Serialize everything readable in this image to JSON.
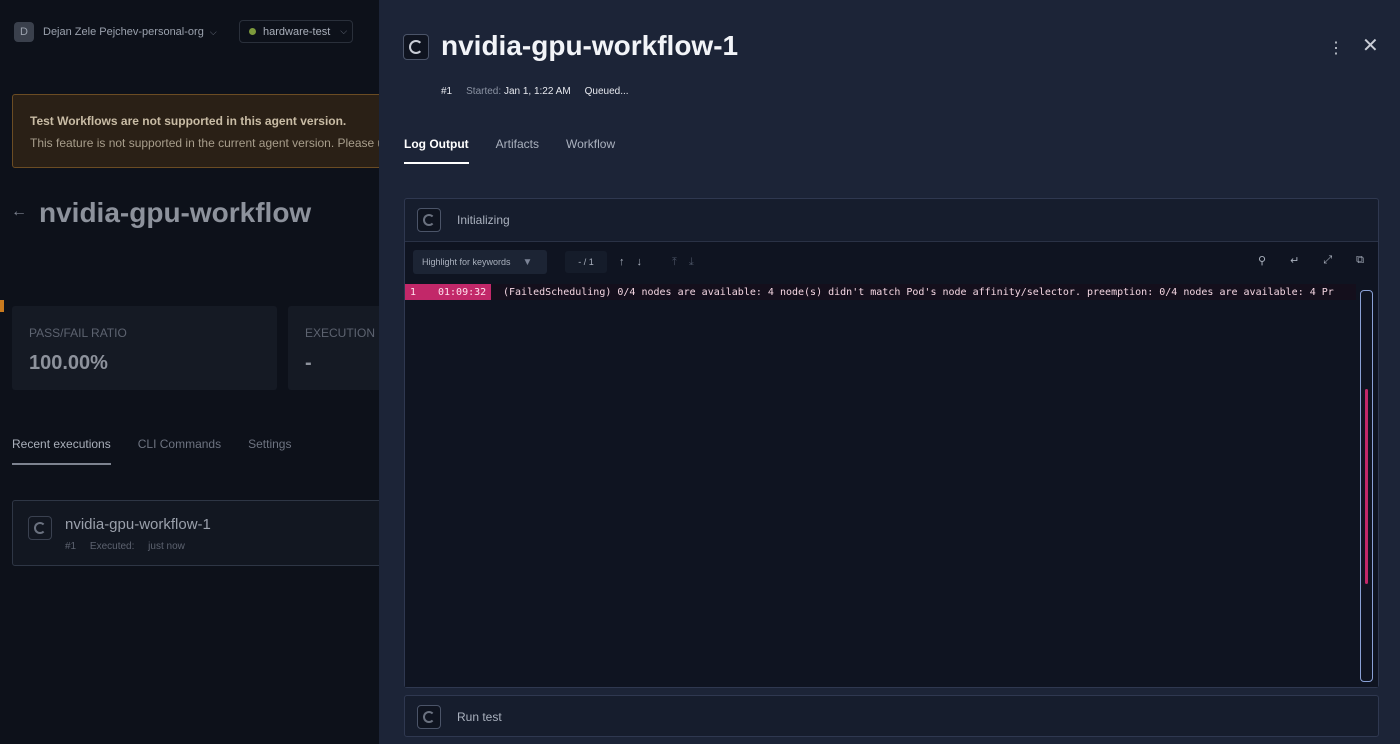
{
  "background": {
    "org": {
      "avatar_letter": "D",
      "name": "Dejan Zele Pejchev-personal-org"
    },
    "environment": {
      "name": "hardware-test",
      "status_color": "#7d9a3c"
    },
    "warning": {
      "title": "Test Workflows are not supported in this agent version.",
      "text": "This feature is not supported in the current agent version. Please u"
    },
    "page_title": "nvidia-gpu-workflow",
    "metrics": [
      {
        "label": "PASS/FAIL RATIO",
        "value": "100.00%"
      },
      {
        "label": "EXECUTION D",
        "value": "-"
      }
    ],
    "tabs": [
      "Recent executions",
      "CLI Commands",
      "Settings"
    ],
    "execution": {
      "name": "nvidia-gpu-workflow-1",
      "number": "#1",
      "executed_label": "Executed:",
      "executed_value": "just now"
    }
  },
  "drawer": {
    "title": "nvidia-gpu-workflow-1",
    "number": "#1",
    "started_label": "Started:",
    "started_value": "Jan 1, 1:22 AM",
    "status": "Queued...",
    "tabs": [
      "Log Output",
      "Artifacts",
      "Workflow"
    ],
    "steps": [
      {
        "name": "Initializing",
        "log": {
          "highlight_placeholder": "Highlight for keywords",
          "match_counter": "- / 1",
          "lines": [
            {
              "number": "1",
              "time": "01:09:32",
              "text": "(FailedScheduling) 0/4 nodes are available: 4 node(s) didn't match Pod's node affinity/selector. preemption: 0/4 nodes are available: 4 Pr"
            }
          ]
        }
      },
      {
        "name": "Run test"
      }
    ]
  },
  "icons": {
    "org_chevron": "chevron-down-icon",
    "back": "arrow-left-icon",
    "more": "more-vertical-icon",
    "close": "close-icon",
    "filter": "filter-icon",
    "search": "search-icon",
    "wrap": "wrap-icon",
    "expand": "expand-icon",
    "copy": "copy-icon"
  },
  "colors": {
    "accent_pink": "#c22869",
    "warning_border": "#6b4c23",
    "drawer_bg": "#1c2437"
  }
}
